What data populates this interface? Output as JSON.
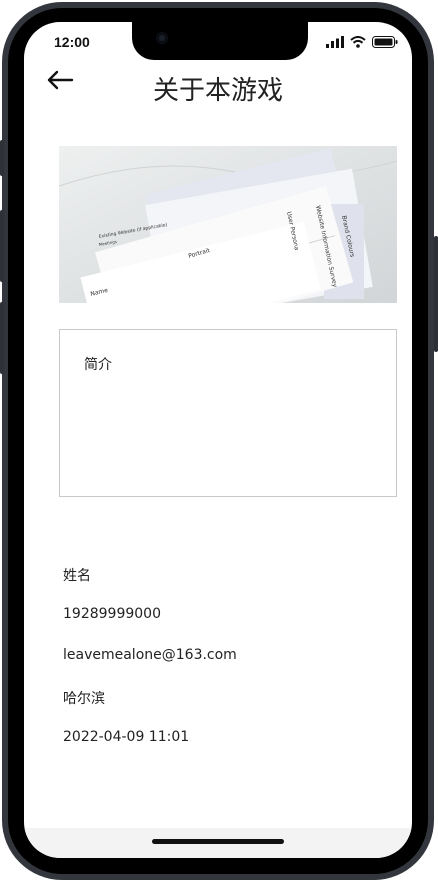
{
  "status_bar": {
    "time": "12:00",
    "icons": [
      "signal-icon",
      "wifi-icon",
      "battery-icon"
    ]
  },
  "header": {
    "title": "关于本游戏",
    "back_icon": "arrow-left-icon"
  },
  "intro": {
    "label": "简介"
  },
  "info": {
    "name": "姓名",
    "phone": "19289999000",
    "email": "leavemealone@163.com",
    "city": "哈尔滨",
    "datetime": "2022-04-09 11:01"
  },
  "hero_image": {
    "doc_texts": [
      "Brand Colours",
      "Website Information Survey",
      "User Persona",
      "Portrait",
      "Name",
      "Existing Website (if applicable)",
      "Meetings"
    ]
  },
  "colors": {
    "device_frame": "#33373d",
    "text": "#222222",
    "border": "#c9c9c9"
  }
}
